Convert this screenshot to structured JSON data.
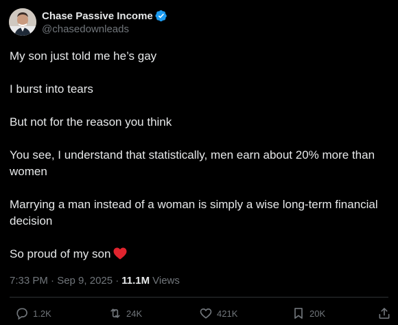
{
  "author": {
    "display_name": "Chase Passive Income",
    "handle": "@chasedownleads"
  },
  "tweet": {
    "paragraphs": [
      "My son just told me he’s gay",
      "I burst into tears",
      "But not for the reason you think",
      "You see, I understand that statistically, men earn about 20% more than women",
      "Marrying a man instead of a woman is simply a wise long-term financial decision",
      "So proud of my son"
    ],
    "emoji": "red-heart"
  },
  "meta": {
    "timestamp": "7:33 PM · Sep 9, 2025 ·",
    "views_count": "11.1M",
    "views_label": "Views"
  },
  "actions": {
    "replies": "1.2K",
    "reposts": "24K",
    "likes": "421K",
    "bookmarks": "20K"
  },
  "colors": {
    "background": "#000000",
    "text": "#e7e9ea",
    "muted": "#71767b",
    "verified": "#1d9bf0",
    "heart": "#f91880",
    "divider": "#2f3336"
  }
}
